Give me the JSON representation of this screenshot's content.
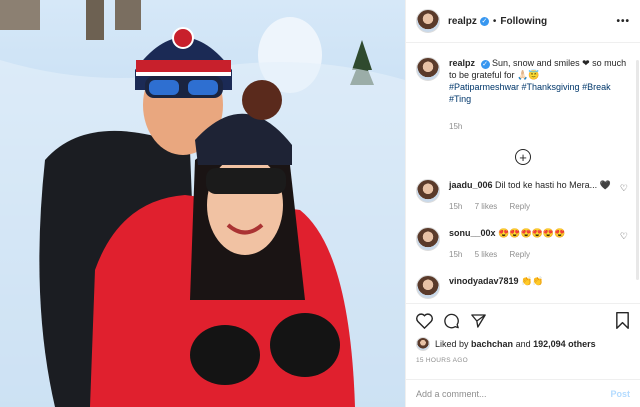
{
  "header": {
    "username": "realpz",
    "separator": "•",
    "follow_status": "Following",
    "more_icon": "more-icon"
  },
  "caption": {
    "username": "realpz",
    "text": "Sun, snow and smiles ❤ so much to be grateful for 🙏🏻😇",
    "hashtags": "#Patiparmeshwar #Thanksgiving #Break #Ting",
    "time": "15h"
  },
  "comments": [
    {
      "user": "jaadu_006",
      "text": "Dil tod ke hasti ho Mera... 🖤",
      "time": "15h",
      "likes": "7 likes",
      "reply": "Reply"
    },
    {
      "user": "sonu__00x",
      "text": "😍😍😍😍😍😍",
      "time": "15h",
      "likes": "5 likes",
      "reply": "Reply"
    },
    {
      "user": "vinodyadav7819",
      "text": "👏👏",
      "time": "",
      "likes": "",
      "reply": ""
    }
  ],
  "likes": {
    "prefix": "Liked by",
    "user": "bachchan",
    "middle": "and",
    "count": "192,094 others"
  },
  "timestamp": "15 HOURS AGO",
  "add_comment": {
    "placeholder": "Add a comment...",
    "post_label": "Post"
  },
  "colors": {
    "link": "#00376b",
    "verified": "#3897f0",
    "post_disabled": "#b3dbff"
  }
}
